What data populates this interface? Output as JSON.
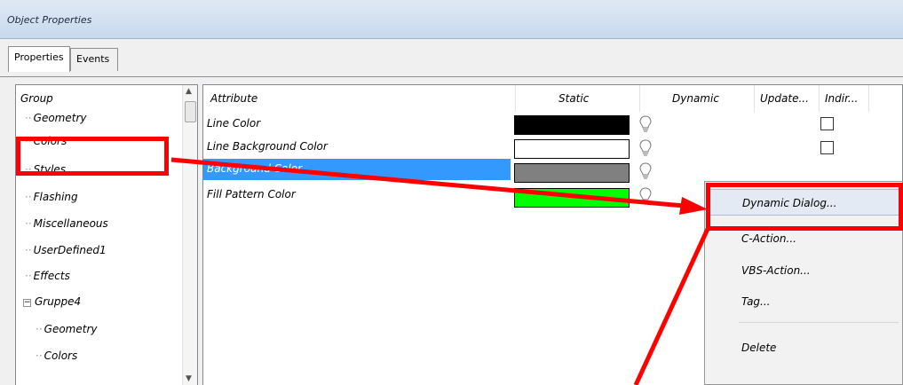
{
  "window": {
    "title": "Object Properties"
  },
  "tabs": [
    {
      "label": "Properties",
      "active": true
    },
    {
      "label": "Events",
      "active": false
    }
  ],
  "tree": {
    "items": [
      {
        "label": "Group",
        "level": 0
      },
      {
        "label": "Geometry",
        "level": 1
      },
      {
        "label": "Colors",
        "level": 1
      },
      {
        "label": "Styles",
        "level": 1
      },
      {
        "label": "Flashing",
        "level": 1
      },
      {
        "label": "Miscellaneous",
        "level": 1
      },
      {
        "label": "UserDefined1",
        "level": 1
      },
      {
        "label": "Effects",
        "level": 1
      },
      {
        "label": "Gruppe4",
        "level": 1,
        "expander": "−"
      },
      {
        "label": "Geometry",
        "level": 2
      },
      {
        "label": "Colors",
        "level": 2
      }
    ]
  },
  "grid": {
    "columns": [
      "Attribute",
      "Static",
      "Dynamic",
      "Update...",
      "Indir..."
    ],
    "rows": [
      {
        "attribute": "Line Color",
        "static_color": "#000000",
        "selected": false
      },
      {
        "attribute": "Line Background Color",
        "static_color": "#ffffff",
        "selected": false
      },
      {
        "attribute": "Background Color",
        "static_color": "#808080",
        "selected": true
      },
      {
        "attribute": "Fill Pattern Color",
        "static_color": "#00ff00",
        "selected": false
      }
    ]
  },
  "context_menu": {
    "items": [
      {
        "label": "Dynamic Dialog...",
        "highlighted": true
      },
      {
        "label": "C-Action..."
      },
      {
        "label": "VBS-Action..."
      },
      {
        "label": "Tag..."
      },
      {
        "label": "Delete"
      }
    ]
  },
  "annotation": {
    "color": "#ff0000"
  },
  "icons": {
    "dynamic": "lightbulb-icon",
    "tree_expand": "minus-expander-icon"
  }
}
